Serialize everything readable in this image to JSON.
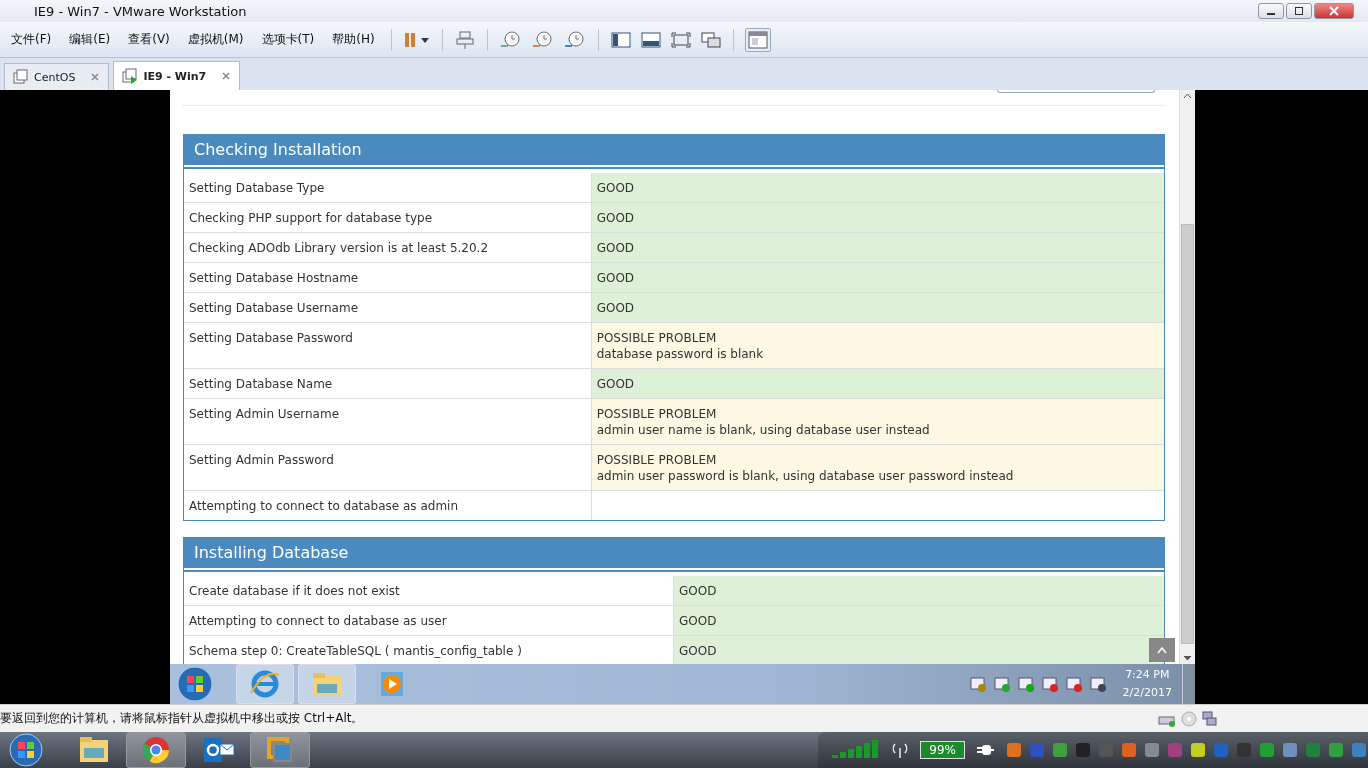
{
  "window": {
    "title": "IE9 - Win7 - VMware Workstation"
  },
  "menu": [
    "文件(F)",
    "编辑(E)",
    "查看(V)",
    "虚拟机(M)",
    "选项卡(T)",
    "帮助(H)"
  ],
  "tabs": [
    {
      "label": "CentOS",
      "selected": false
    },
    {
      "label": "IE9 - Win7",
      "selected": true
    }
  ],
  "sections": [
    {
      "title": "Checking Installation",
      "rows": [
        {
          "label": "Setting Database Type",
          "kind": "good",
          "status": "GOOD"
        },
        {
          "label": "Checking PHP support for database type",
          "kind": "good",
          "status": "GOOD"
        },
        {
          "label": "Checking ADOdb Library version is at least 5.20.2",
          "kind": "good",
          "status": "GOOD"
        },
        {
          "label": "Setting Database Hostname",
          "kind": "good",
          "status": "GOOD"
        },
        {
          "label": "Setting Database Username",
          "kind": "good",
          "status": "GOOD"
        },
        {
          "label": "Setting Database Password",
          "kind": "problem",
          "status": "POSSIBLE PROBLEM",
          "detail": "database password is blank"
        },
        {
          "label": "Setting Database Name",
          "kind": "good",
          "status": "GOOD"
        },
        {
          "label": "Setting Admin Username",
          "kind": "problem",
          "status": "POSSIBLE PROBLEM",
          "detail": "admin user name is blank, using database user instead"
        },
        {
          "label": "Setting Admin Password",
          "kind": "problem",
          "status": "POSSIBLE PROBLEM",
          "detail": "admin user password is blank, using database user password instead"
        },
        {
          "label": "Attempting to connect to database as admin",
          "kind": "none"
        }
      ]
    },
    {
      "title": "Installing Database",
      "rows": [
        {
          "label": "Create database if it does not exist",
          "kind": "good",
          "status": "GOOD"
        },
        {
          "label": "Attempting to connect to database as user",
          "kind": "good",
          "status": "GOOD"
        },
        {
          "label": "Schema step 0: CreateTableSQL ( mantis_config_table )",
          "kind": "good",
          "status": "GOOD"
        }
      ]
    }
  ],
  "guest_taskbar": {
    "time": "7:24 PM",
    "date": "2/2/2017"
  },
  "status_bar": {
    "message": "要返回到您的计算机，请将鼠标指针从虚拟机中移出或按 Ctrl+Alt。"
  },
  "host_taskbar": {
    "battery": "99%"
  }
}
